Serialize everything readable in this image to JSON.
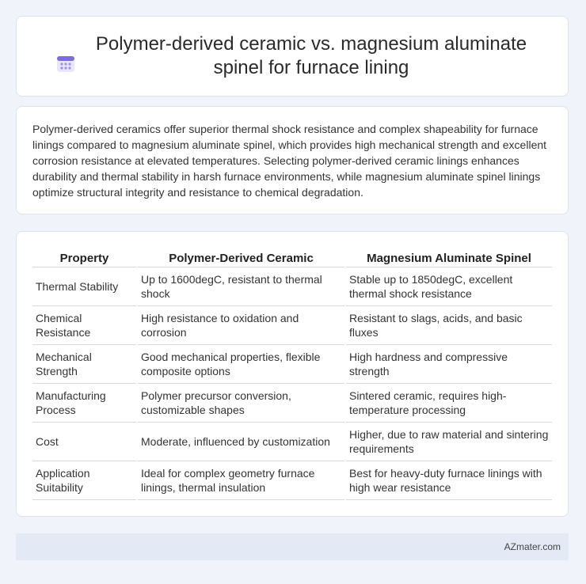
{
  "header": {
    "title": "Polymer-derived ceramic vs. magnesium aluminate spinel for furnace lining",
    "icon": "calendar-icon"
  },
  "summary": {
    "text": "Polymer-derived ceramics offer superior thermal shock resistance and complex shapeability for furnace linings compared to magnesium aluminate spinel, which provides high mechanical strength and excellent corrosion resistance at elevated temperatures. Selecting polymer-derived ceramic linings enhances durability and thermal stability in harsh furnace environments, while magnesium aluminate spinel linings optimize structural integrity and resistance to chemical degradation."
  },
  "table": {
    "headers": [
      "Property",
      "Polymer-Derived Ceramic",
      "Magnesium Aluminate Spinel"
    ],
    "rows": [
      [
        "Thermal Stability",
        "Up to 1600degC, resistant to thermal shock",
        "Stable up to 1850degC, excellent thermal shock resistance"
      ],
      [
        "Chemical Resistance",
        "High resistance to oxidation and corrosion",
        "Resistant to slags, acids, and basic fluxes"
      ],
      [
        "Mechanical Strength",
        "Good mechanical properties, flexible composite options",
        "High hardness and compressive strength"
      ],
      [
        "Manufacturing Process",
        "Polymer precursor conversion, customizable shapes",
        "Sintered ceramic, requires high-temperature processing"
      ],
      [
        "Cost",
        "Moderate, influenced by customization",
        "Higher, due to raw material and sintering requirements"
      ],
      [
        "Application Suitability",
        "Ideal for complex geometry furnace linings, thermal insulation",
        "Best for heavy-duty furnace linings with high wear resistance"
      ]
    ]
  },
  "footer": {
    "brand": "AZmater.com"
  },
  "colors": {
    "background": "#f0f3f9",
    "icon_accent": "#7b6fd6",
    "footer_bg": "#e4eaf5"
  }
}
